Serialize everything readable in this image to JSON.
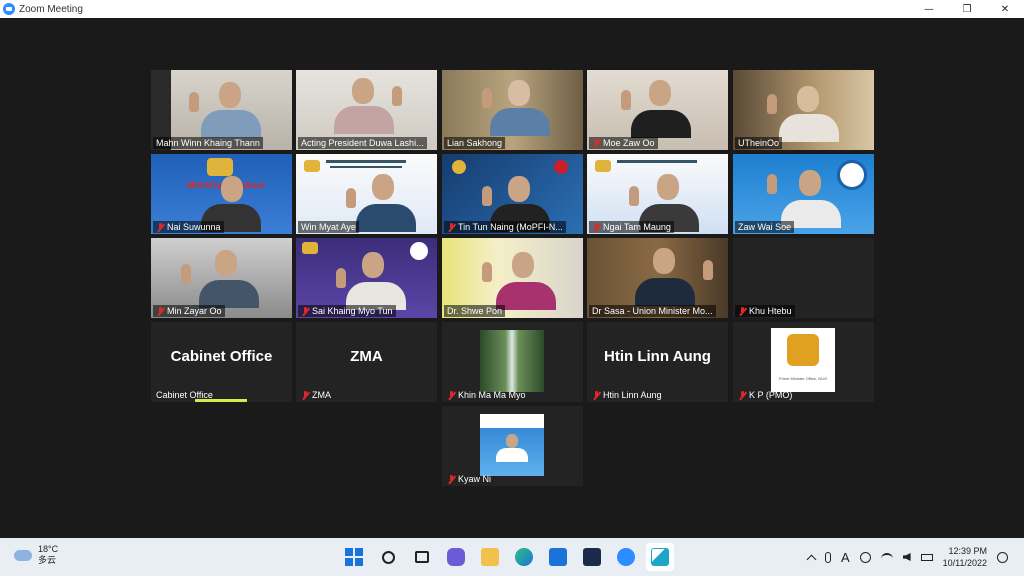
{
  "window": {
    "title": "Zoom Meeting",
    "minimize": "—",
    "restore": "❐",
    "close": "✕"
  },
  "participants": [
    {
      "name": "Mahn Winn Khaing Thann",
      "muted": false
    },
    {
      "name": "Acting President Duwa Lashi...",
      "muted": false
    },
    {
      "name": "Lian Sakhong",
      "muted": false
    },
    {
      "name": "Moe Zaw Oo",
      "muted": true
    },
    {
      "name": "UTheinOo",
      "muted": false
    },
    {
      "name": "Nai Suwunna",
      "muted": true
    },
    {
      "name": "Win Myat Aye",
      "muted": false
    },
    {
      "name": "Tin Tun Naing (MoPFI-N...",
      "muted": true
    },
    {
      "name": "Ngai Tam Maung",
      "muted": true
    },
    {
      "name": "Zaw Wai Soe",
      "muted": false
    },
    {
      "name": "Min Zayar Oo",
      "muted": true
    },
    {
      "name": "Sai Khaing Myo Tun",
      "muted": true
    },
    {
      "name": "Dr. Shwe Pon",
      "muted": false
    },
    {
      "name": "Dr Sasa - Union Minister Mo...",
      "muted": false
    },
    {
      "name": "Khu Htebu",
      "muted": true
    },
    {
      "name": "Cabinet Office",
      "muted": false,
      "display": "Cabinet Office"
    },
    {
      "name": "ZMA",
      "muted": true,
      "display": "ZMA"
    },
    {
      "name": "Khin Ma Ma Myo",
      "muted": true
    },
    {
      "name": "Htin Linn Aung",
      "muted": true,
      "display": "Htin Linn Aung"
    },
    {
      "name": "K P (PMO)",
      "muted": true
    },
    {
      "name": "Kyaw Ni",
      "muted": true
    }
  ],
  "banner_text": "Ministry of Labour",
  "pmo_caption": "Prime Minister Office, NUG",
  "taskbar": {
    "temperature": "18°C",
    "condition": "多云",
    "time": "12:39 PM",
    "date": "10/11/2022",
    "font_indicator": "A"
  },
  "colors": {
    "active_speaker": "#d9e84a",
    "mute_red": "#e02828",
    "zoom_blue": "#2d8cff"
  }
}
